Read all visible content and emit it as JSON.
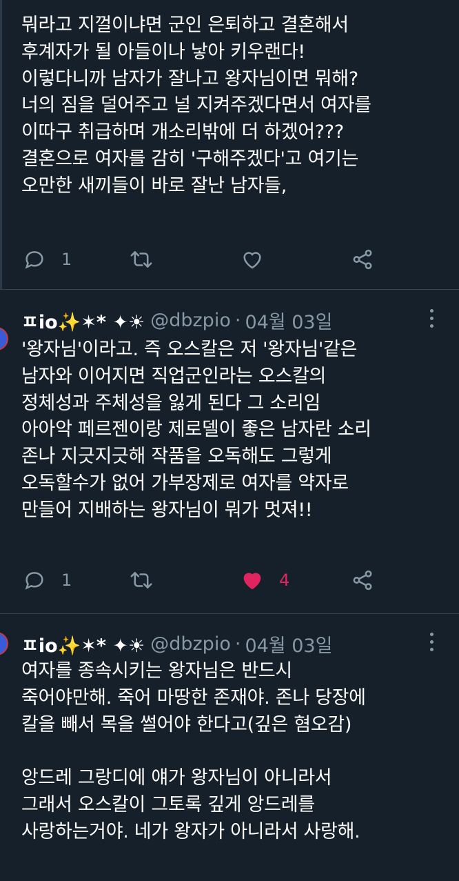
{
  "tweets": [
    {
      "text": "뭐라고 지껄이냐면 군인 은퇴하고 결혼해서\n후계자가 될 아들이나 낳아 키우랜다!\n이렇다니까 남자가 잘나고 왕자님이면 뭐해?\n너의 짐을 덜어주고 널 지켜주겠다면서 여자를\n이따구 취급하며 개소리밖에 더 하겠어???\n결혼으로 여자를 감히 '구해주겠다'고 여기는\n오만한 새끼들이 바로 잘난 남자들,",
      "reply_count": "1",
      "like_count": "",
      "liked": false
    },
    {
      "name": "ㅍio✨✶* ✦☀",
      "handle": "@dbzpio",
      "separator": "·",
      "date": "04월 03일",
      "text": "'왕자님'이라고. 즉 오스칼은 저 '왕자님'같은\n남자와 이어지면 직업군인라는 오스칼의\n정체성과 주체성을 잃게 된다 그 소리임\n아아악 페르젠이랑 제로델이 좋은 남자란 소리\n존나 지긋지긋해 작품을 오독해도 그렇게\n오독할수가 없어 가부장제로 여자를 약자로\n만들어 지배하는 왕자님이 뭐가 멋져!!",
      "reply_count": "1",
      "like_count": "4",
      "liked": true
    },
    {
      "name": "ㅍio✨✶* ✦☀",
      "handle": "@dbzpio",
      "separator": "·",
      "date": "04월 03일",
      "text": "여자를 종속시키는 왕자님은 반드시\n죽어야만해. 죽어 마땅한 존재야. 존나 당장에\n칼을 빼서 목을 썰어야 한다고(깊은 혐오감)\n\n앙드레 그랑디에 얘가 왕자님이 아니라서\n그래서 오스칼이 그토록 깊게 앙드레를\n사랑하는거야. 네가 왕자가 아니라서 사랑해."
    }
  ],
  "colors": {
    "background": "#15202b",
    "text": "#ffffff",
    "muted": "#8899a6",
    "like": "#e0245e"
  }
}
